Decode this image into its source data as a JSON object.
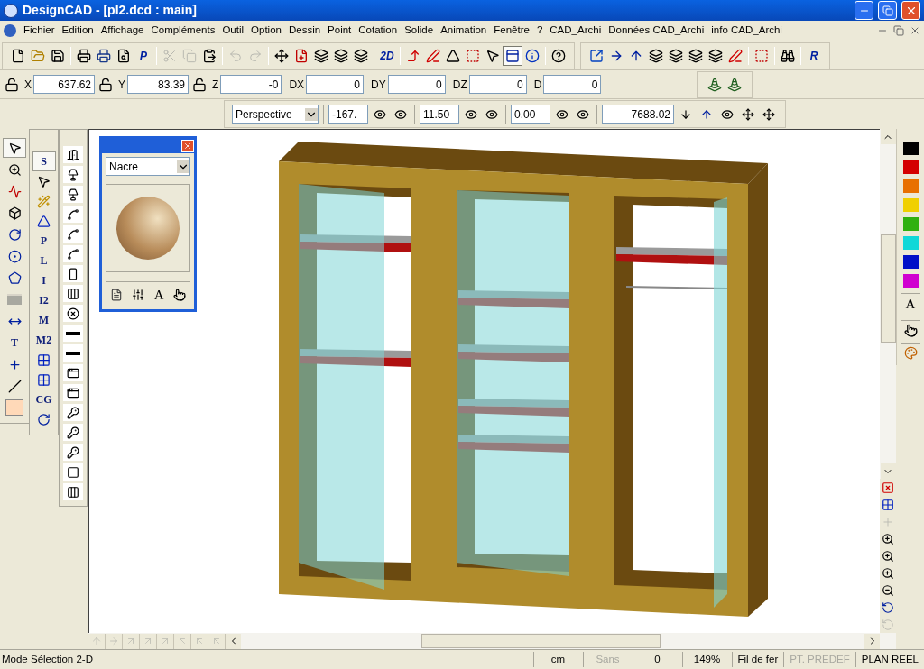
{
  "window": {
    "title": "DesignCAD - [pl2.dcd : main]"
  },
  "menu": [
    "Fichier",
    "Edition",
    "Affichage",
    "Compléments",
    "Outil",
    "Option",
    "Dessin",
    "Point",
    "Cotation",
    "Solide",
    "Animation",
    "Fenêtre",
    "?",
    "CAD_Archi",
    "Données CAD_Archi",
    "info CAD_Archi"
  ],
  "toolbar": [
    {
      "kind": "new",
      "disabled": false,
      "pressed": false
    },
    {
      "kind": "open",
      "disabled": false,
      "pressed": false
    },
    {
      "kind": "save",
      "disabled": false,
      "pressed": false
    },
    {
      "kind": "sep"
    },
    {
      "kind": "print",
      "disabled": false,
      "pressed": false
    },
    {
      "kind": "printsetup",
      "disabled": false,
      "pressed": false
    },
    {
      "kind": "preview",
      "disabled": false,
      "pressed": false
    },
    {
      "kind": "letter",
      "label": "P",
      "disabled": false,
      "pressed": false
    },
    {
      "kind": "sep"
    },
    {
      "kind": "cut",
      "disabled": true,
      "pressed": false
    },
    {
      "kind": "copy",
      "disabled": true,
      "pressed": false
    },
    {
      "kind": "paste",
      "disabled": false,
      "pressed": false
    },
    {
      "kind": "sep"
    },
    {
      "kind": "undo",
      "disabled": true,
      "pressed": false
    },
    {
      "kind": "redo",
      "disabled": true,
      "pressed": false
    },
    {
      "kind": "sep"
    },
    {
      "kind": "move",
      "disabled": false,
      "pressed": false
    },
    {
      "kind": "insert",
      "disabled": false,
      "pressed": false
    },
    {
      "kind": "layers",
      "disabled": false,
      "pressed": false
    },
    {
      "kind": "layers",
      "disabled": false,
      "pressed": false
    },
    {
      "kind": "layers",
      "disabled": false,
      "pressed": false
    },
    {
      "kind": "sep"
    },
    {
      "kind": "letter",
      "label": "2D",
      "disabled": false,
      "pressed": false
    },
    {
      "kind": "sep"
    },
    {
      "kind": "axes",
      "disabled": false,
      "pressed": false
    },
    {
      "kind": "angle",
      "disabled": false,
      "pressed": false
    },
    {
      "kind": "mirror",
      "disabled": false,
      "pressed": false
    },
    {
      "kind": "handles",
      "disabled": false,
      "pressed": false
    },
    {
      "kind": "pick",
      "disabled": false,
      "pressed": false
    },
    {
      "kind": "window",
      "disabled": false,
      "pressed": true
    },
    {
      "kind": "info",
      "disabled": false,
      "pressed": false
    },
    {
      "kind": "sep"
    },
    {
      "kind": "help",
      "disabled": false,
      "pressed": false
    }
  ],
  "toolbar_right": [
    {
      "kind": "export",
      "disabled": false,
      "pressed": false
    },
    {
      "kind": "right",
      "disabled": false,
      "pressed": false
    },
    {
      "kind": "up",
      "disabled": false,
      "pressed": false
    },
    {
      "kind": "layers",
      "disabled": false,
      "pressed": false
    },
    {
      "kind": "layers",
      "disabled": false,
      "pressed": false
    },
    {
      "kind": "layers",
      "disabled": false,
      "pressed": false
    },
    {
      "kind": "layers",
      "disabled": false,
      "pressed": false
    },
    {
      "kind": "angle",
      "disabled": false,
      "pressed": false
    },
    {
      "kind": "sep"
    },
    {
      "kind": "handles",
      "disabled": false,
      "pressed": false
    },
    {
      "kind": "sep"
    },
    {
      "kind": "binoculars",
      "disabled": false,
      "pressed": false
    },
    {
      "kind": "sep"
    },
    {
      "kind": "letter",
      "label": "R",
      "disabled": false,
      "pressed": false
    }
  ],
  "coordinates": [
    {
      "kind": "lock",
      "label": "X",
      "value": "637.62"
    },
    {
      "kind": "lock",
      "label": "Y",
      "value": "83.39"
    },
    {
      "kind": "lock",
      "label": "Z",
      "value": "-0"
    },
    {
      "kind": "plain",
      "label": "DX",
      "value": "0"
    },
    {
      "kind": "plain",
      "label": "DY",
      "value": "0"
    },
    {
      "kind": "plain",
      "label": "DZ",
      "value": "0"
    },
    {
      "kind": "plain",
      "label": "D",
      "value": "0"
    }
  ],
  "layer_tools": [
    {
      "kind": "light",
      "disabled": false,
      "pressed": false
    },
    {
      "kind": "light",
      "disabled": false,
      "pressed": false
    }
  ],
  "view_bar": [
    {
      "kind": "select",
      "value": "Perspective"
    },
    {
      "kind": "sep"
    },
    {
      "kind": "field",
      "value": "-167."
    },
    {
      "kind": "eye"
    },
    {
      "kind": "eye"
    },
    {
      "kind": "sep"
    },
    {
      "kind": "field",
      "value": "11.50"
    },
    {
      "kind": "eye"
    },
    {
      "kind": "eye"
    },
    {
      "kind": "sep"
    },
    {
      "kind": "field",
      "value": "0.00"
    },
    {
      "kind": "eye"
    },
    {
      "kind": "eye"
    },
    {
      "kind": "sep"
    },
    {
      "kind": "wide",
      "value": "7688.02"
    },
    {
      "kind": "down"
    },
    {
      "kind": "up"
    },
    {
      "kind": "eye"
    },
    {
      "kind": "move"
    },
    {
      "kind": "move"
    }
  ],
  "draw_tools": [
    {
      "kind": "pointer",
      "selected": true
    },
    {
      "kind": "zoom",
      "selected": false
    },
    {
      "kind": "polyline",
      "selected": false
    },
    {
      "kind": "cube",
      "selected": false
    },
    {
      "kind": "arc",
      "selected": false
    },
    {
      "kind": "circle",
      "selected": false
    },
    {
      "kind": "polygon",
      "selected": false
    },
    {
      "kind": "fill",
      "selected": false
    },
    {
      "kind": "dimension",
      "selected": false
    },
    {
      "kind": "letter",
      "label": "T",
      "selected": false
    },
    {
      "kind": "cross",
      "selected": false
    },
    {
      "kind": "dashed",
      "selected": false
    },
    {
      "kind": "swatch",
      "selected": false
    }
  ],
  "snap_tools": [
    {
      "kind": "letter",
      "label": "S",
      "selected": true
    },
    {
      "kind": "pointer",
      "selected": false
    },
    {
      "kind": "wand",
      "selected": false
    },
    {
      "kind": "triangle",
      "selected": false
    },
    {
      "kind": "letter",
      "label": "P",
      "selected": false
    },
    {
      "kind": "letter",
      "label": "L",
      "selected": false
    },
    {
      "kind": "letter",
      "label": "I",
      "selected": false
    },
    {
      "kind": "letter",
      "label": "I2",
      "selected": false
    },
    {
      "kind": "letter",
      "label": "M",
      "selected": false
    },
    {
      "kind": "letter",
      "label": "M2",
      "selected": false
    },
    {
      "kind": "grid",
      "selected": false
    },
    {
      "kind": "grid",
      "selected": false
    },
    {
      "kind": "letter",
      "label": "CG",
      "selected": false
    },
    {
      "kind": "arc",
      "selected": false
    }
  ],
  "symbol_tools": [
    {
      "kind": "door"
    },
    {
      "kind": "lamp"
    },
    {
      "kind": "lamp"
    },
    {
      "kind": "arc"
    },
    {
      "kind": "arc"
    },
    {
      "kind": "arc"
    },
    {
      "kind": "cabinet"
    },
    {
      "kind": "window"
    },
    {
      "kind": "circle"
    },
    {
      "kind": "bar"
    },
    {
      "kind": "bar"
    },
    {
      "kind": "frame"
    },
    {
      "kind": "frame"
    },
    {
      "kind": "key"
    },
    {
      "kind": "key"
    },
    {
      "kind": "key"
    },
    {
      "kind": "block"
    },
    {
      "kind": "window"
    }
  ],
  "material_panel": {
    "material": "Nacre",
    "tools": [
      {
        "kind": "doc"
      },
      {
        "kind": "sliders"
      },
      {
        "kind": "letter",
        "label": "A"
      },
      {
        "kind": "hand"
      }
    ]
  },
  "colors": [
    {
      "color": "#000000"
    },
    {
      "color": "#d40000"
    },
    {
      "color": "#e87000"
    },
    {
      "color": "#f0d000"
    },
    {
      "color": "#30b010"
    },
    {
      "color": "#10d8d8"
    },
    {
      "color": "#0010c8"
    },
    {
      "color": "#d000d0"
    }
  ],
  "palette_tools": [
    {
      "kind": "letter",
      "label": "A"
    },
    {
      "kind": "hand"
    },
    {
      "kind": "paint"
    }
  ],
  "view_tools": [
    {
      "kind": "clear",
      "disabled": false
    },
    {
      "kind": "grid",
      "disabled": false
    },
    {
      "kind": "cross",
      "disabled": true
    },
    {
      "kind": "zoom",
      "disabled": false
    },
    {
      "kind": "zoom",
      "disabled": false
    },
    {
      "kind": "zoomin",
      "disabled": false
    },
    {
      "kind": "zoomout",
      "disabled": false
    },
    {
      "kind": "rotate",
      "disabled": false
    },
    {
      "kind": "rotate",
      "disabled": true
    }
  ],
  "direction_tools": [
    {
      "kind": "up"
    },
    {
      "kind": "right"
    },
    {
      "kind": "diag"
    },
    {
      "kind": "diag"
    },
    {
      "kind": "diag"
    },
    {
      "kind": "left"
    },
    {
      "kind": "left"
    },
    {
      "kind": "left"
    }
  ],
  "status_bar": [
    {
      "text": "Mode Sélection 2-D",
      "disabled": false
    },
    {
      "text": "cm",
      "disabled": false
    },
    {
      "text": "Sans",
      "disabled": true
    },
    {
      "text": "0",
      "disabled": false
    },
    {
      "text": "149%",
      "disabled": false
    },
    {
      "text": "Fil de fer",
      "disabled": false
    },
    {
      "text": "PT. PREDEF",
      "disabled": true
    },
    {
      "text": "PLAN REEL",
      "disabled": false
    }
  ]
}
